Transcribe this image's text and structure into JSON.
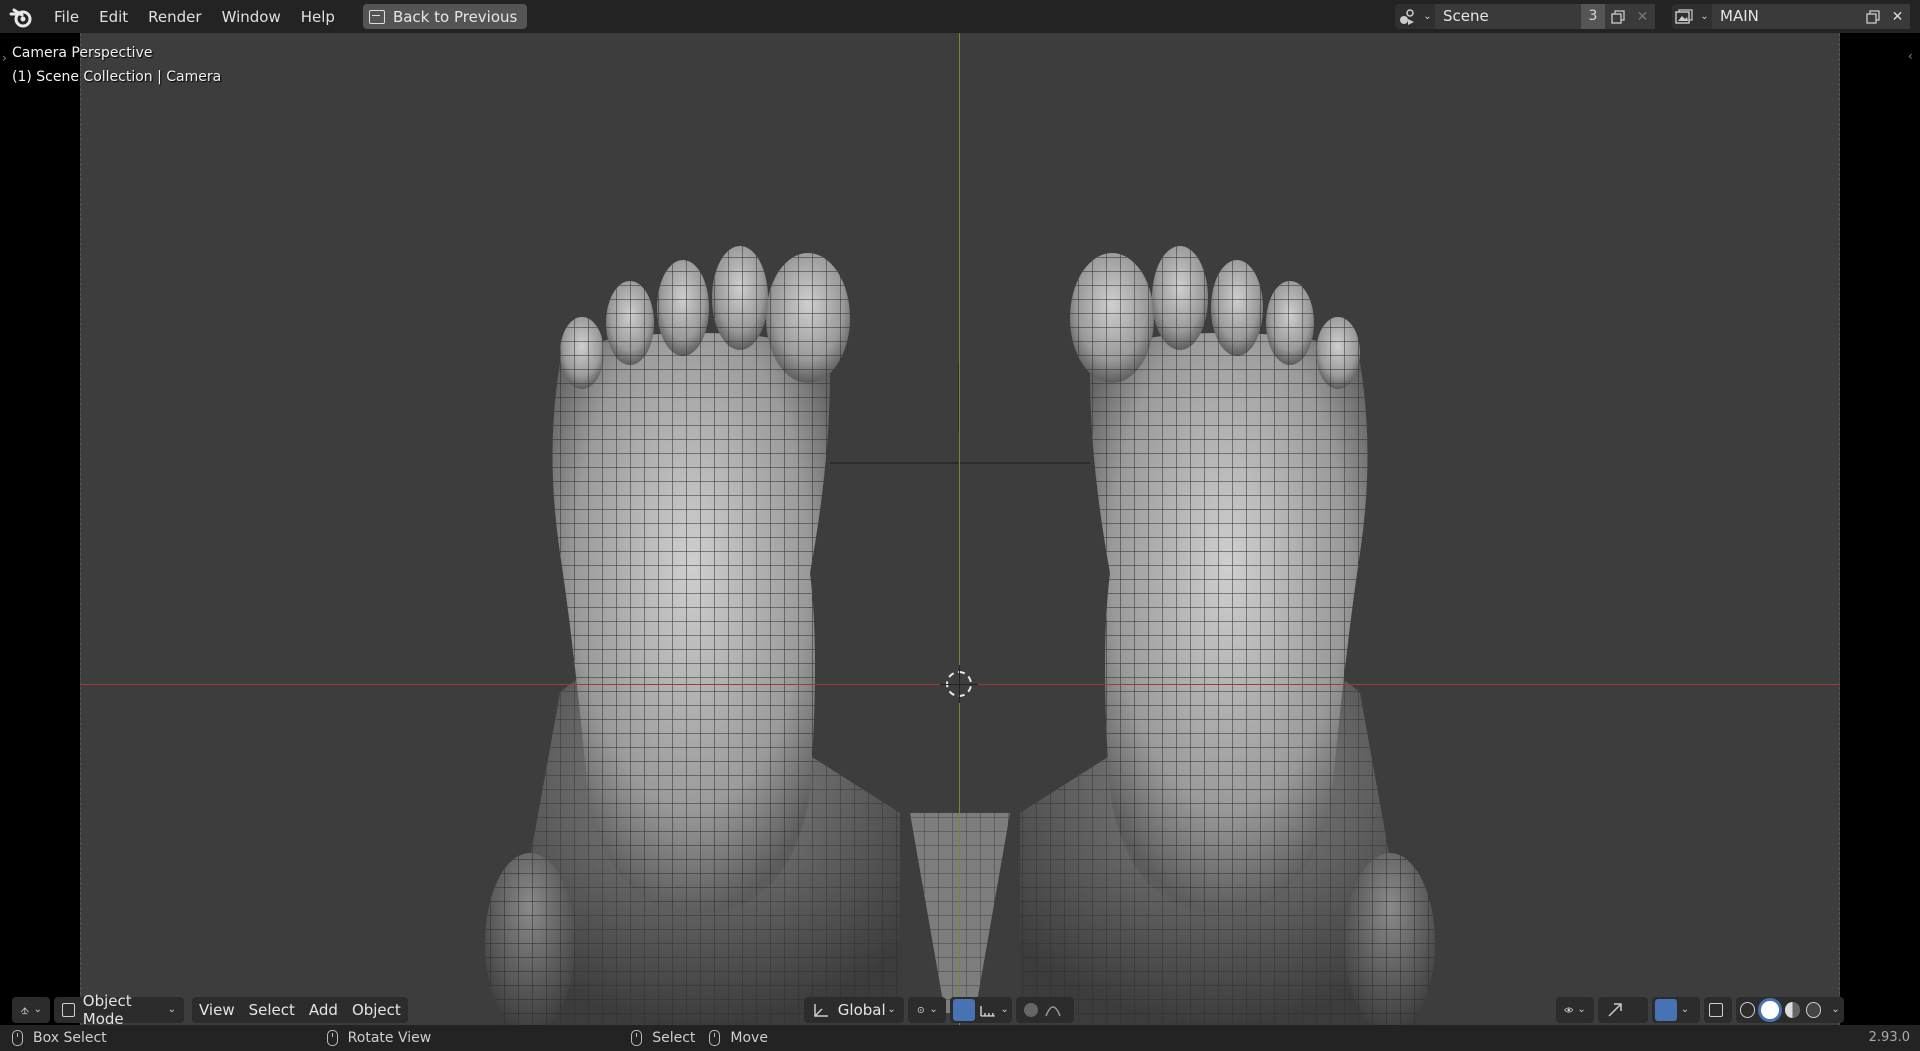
{
  "topbar": {
    "menus": [
      "File",
      "Edit",
      "Render",
      "Window",
      "Help"
    ],
    "back_button": "Back to Previous",
    "scene_name": "Scene",
    "scene_users": "3",
    "view_layer": "MAIN"
  },
  "viewport": {
    "overlay_title": "Camera Perspective",
    "overlay_subtitle": "(1) Scene Collection | Camera"
  },
  "header": {
    "mode": "Object Mode",
    "menus": [
      "View",
      "Select",
      "Add",
      "Object"
    ],
    "orientation": "Global"
  },
  "statusbar": {
    "left_action": "Box Select",
    "middle_action": "Rotate View",
    "right_select": "Select",
    "right_move": "Move",
    "version": "2.93.0"
  },
  "colors": {
    "x_axis": "#a03a3a",
    "y_axis": "#6d8f2d",
    "active_blue": "#4772b3"
  }
}
